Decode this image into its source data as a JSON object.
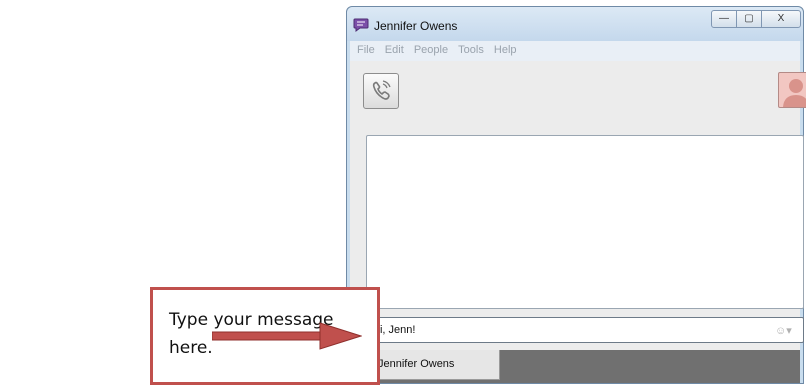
{
  "window": {
    "title": "Jennifer Owens",
    "controls": {
      "minimize": "—",
      "maximize": "▢",
      "close": "X"
    }
  },
  "menubar": {
    "items": [
      "File",
      "Edit",
      "People",
      "Tools",
      "Help"
    ]
  },
  "toolbar": {
    "call_icon": "phone-icon",
    "avatar_icon": "contact-avatar-icon"
  },
  "composer": {
    "message": "Hi, Jenn!",
    "emoticon_icon": "smiley-icon"
  },
  "tabs": [
    {
      "label": "Jennifer Owens",
      "status_color": "#7ed321"
    }
  ],
  "callout": {
    "text": "Type your message here.",
    "color": "#c0504d"
  }
}
